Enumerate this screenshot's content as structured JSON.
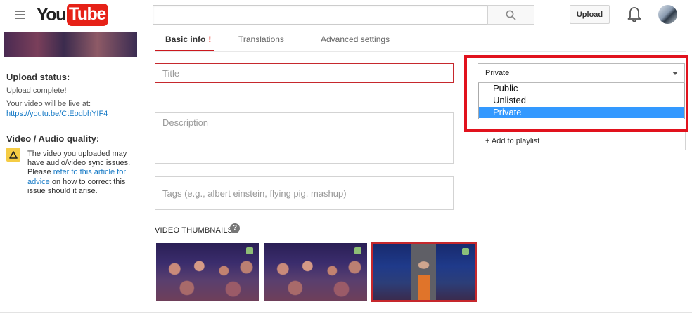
{
  "header": {
    "logo": {
      "you": "You",
      "tube": "Tube"
    },
    "search": {
      "placeholder": "",
      "value": ""
    },
    "upload_label": "Upload",
    "icons": [
      "menu-icon",
      "search-icon",
      "bell-icon",
      "avatar"
    ]
  },
  "sidebar": {
    "upload_status_title": "Upload status:",
    "upload_status_text": "Upload complete!",
    "live_label": "Your video will be live at:",
    "live_link": "https://youtu.be/CtEodbhYIF4",
    "quality_title": "Video / Audio quality:",
    "warning": {
      "text_before": "The video you uploaded may have audio/video sync issues. Please ",
      "link": "refer to this article for advice",
      "text_after": " on how to correct this issue should it arise."
    }
  },
  "tabs": [
    {
      "label": "Basic info",
      "badge": "!",
      "active": true
    },
    {
      "label": "Translations",
      "active": false
    },
    {
      "label": "Advanced settings",
      "active": false
    }
  ],
  "form": {
    "title_placeholder": "Title",
    "description_placeholder": "Description",
    "tags_placeholder": "Tags (e.g., albert einstein, flying pig, mashup)",
    "thumbnails_label": "VIDEO THUMBNAILS",
    "help_glyph": "?"
  },
  "privacy": {
    "selected": "Private",
    "options": [
      "Public",
      "Unlisted",
      "Private"
    ],
    "highlighted": "Private"
  },
  "playlist_label": "+ Add to playlist",
  "colors": {
    "brand_red": "#e62117",
    "highlight_box": "#e1121d",
    "link_blue": "#167ac6",
    "selected_option": "#3399ff",
    "warning_yellow": "#f5cc44"
  }
}
